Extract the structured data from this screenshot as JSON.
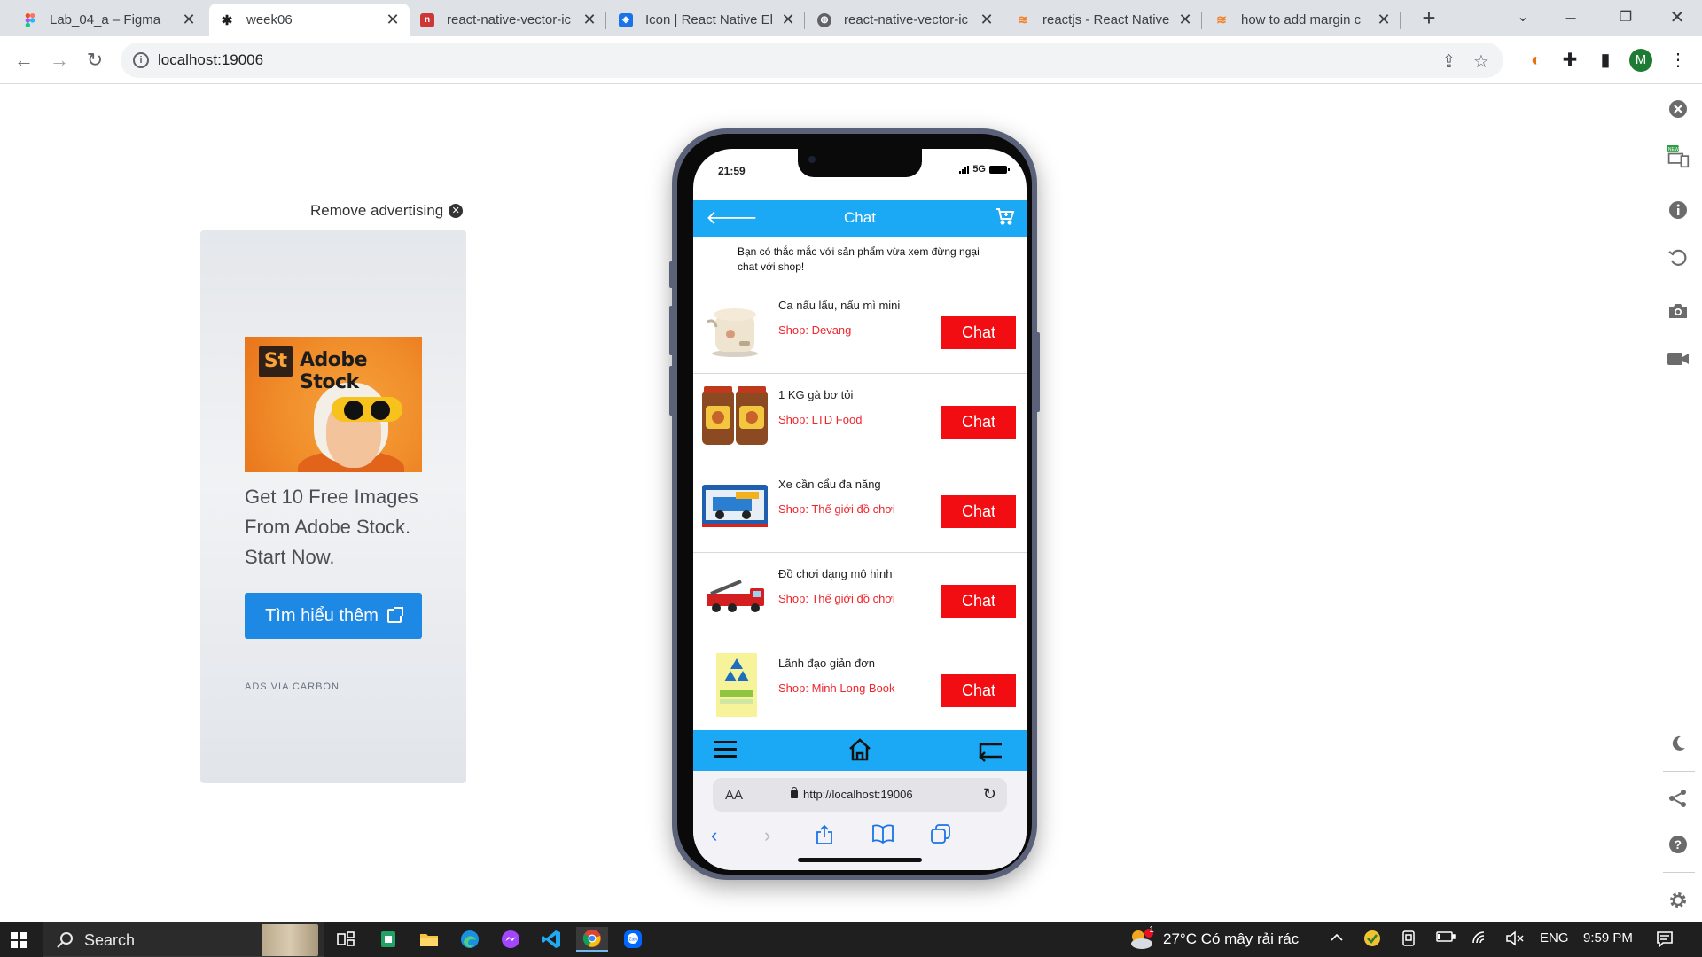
{
  "browser": {
    "tabs": [
      {
        "label": "Lab_04_a – Figma",
        "icon": "figma-icon",
        "color": "#f24e1e",
        "active": false
      },
      {
        "label": "week06",
        "icon": "expo-icon",
        "color": "#1f1f1f",
        "active": true
      },
      {
        "label": "react-native-vector-ic",
        "icon": "npm-icon",
        "color": "#cb3837",
        "active": false
      },
      {
        "label": "Icon | React Native El",
        "icon": "rne-icon",
        "color": "#1a73e8",
        "active": false
      },
      {
        "label": "react-native-vector-ic",
        "icon": "globe-icon",
        "color": "#5f6368",
        "active": false
      },
      {
        "label": "reactjs - React Native",
        "icon": "stackoverflow-icon",
        "color": "#f48024",
        "active": false
      },
      {
        "label": "how to add margin c",
        "icon": "stackoverflow-icon",
        "color": "#f48024",
        "active": false
      }
    ],
    "new_tab": "+",
    "url": "localhost:19006",
    "profile_initial": "M"
  },
  "ad": {
    "remove_label": "Remove advertising",
    "brand_badge": "St",
    "brand_name": "Adobe Stock",
    "text": "Get 10 Free Images From Adobe Stock. Start Now.",
    "cta": "Tìm hiểu thêm",
    "via": "ADS VIA CARBON"
  },
  "phone": {
    "time": "21:59",
    "network": "5G",
    "header_title": "Chat",
    "notice": "Bạn có thắc mắc với sản phẩm vừa xem đừng ngại chat với shop!",
    "chat_label": "Chat",
    "items": [
      {
        "name": "Ca nấu lẩu, nấu mì mini",
        "shop": "Shop: Devang",
        "thumb": "cooker-image"
      },
      {
        "name": "1 KG gà bơ tỏi",
        "shop": "Shop: LTD Food",
        "thumb": "chicken-jar-image"
      },
      {
        "name": "Xe cần cẩu đa năng",
        "shop": "Shop: Thế giới đồ chơi",
        "thumb": "crane-truck-image"
      },
      {
        "name": "Đồ chơi dạng mô hình",
        "shop": "Shop: Thế giới đồ chơi",
        "thumb": "fire-truck-image"
      },
      {
        "name": "Lãnh đạo giản đơn",
        "shop": "Shop: Minh Long Book",
        "thumb": "book-image"
      }
    ],
    "safari": {
      "aa": "AA",
      "url": "http://localhost:19006"
    },
    "colors": {
      "header": "#1ba9f5",
      "chat_button": "#f20d12",
      "shop_text": "#f0262d"
    }
  },
  "taskbar": {
    "search_label": "Search",
    "weather": "27°C  Có mây rải rác",
    "weather_badge": "1",
    "language": "ENG",
    "clock": "9:59 PM"
  }
}
